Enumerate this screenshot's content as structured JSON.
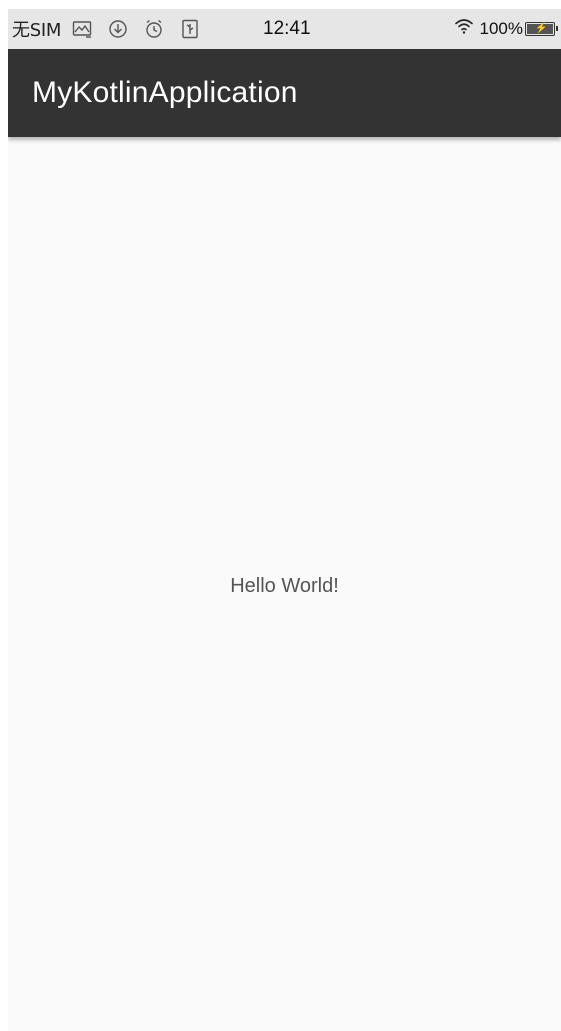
{
  "status_bar": {
    "carrier": "无SIM",
    "time": "12:41",
    "battery_text": "100%",
    "battery_level": 1.0,
    "icons": [
      "gallery-icon",
      "download-icon",
      "alarm-icon",
      "usb-icon",
      "wifi-icon",
      "battery-icon"
    ]
  },
  "app_bar": {
    "title": "MyKotlinApplication",
    "background_color": "#333333"
  },
  "main": {
    "message": "Hello World!"
  }
}
